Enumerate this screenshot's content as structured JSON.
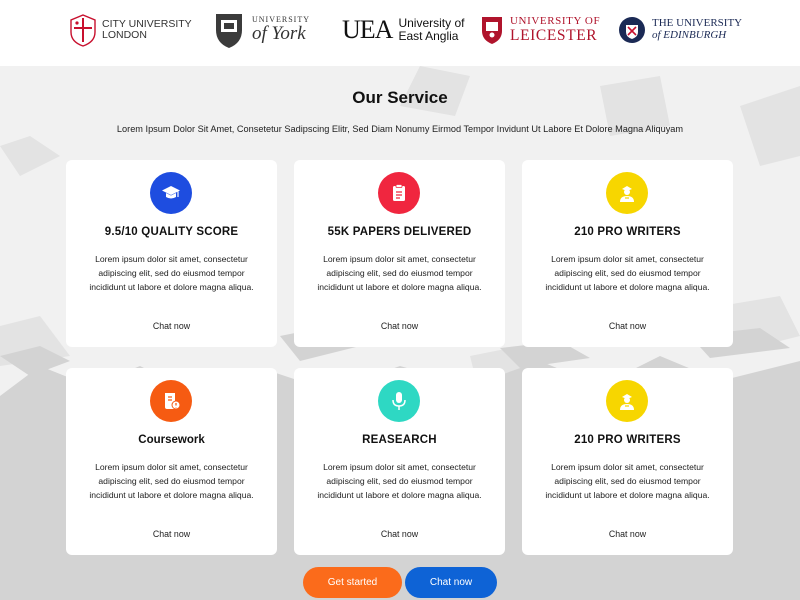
{
  "logos": {
    "city": {
      "line1": "CITY UNIVERSITY",
      "line2": "LONDON"
    },
    "york": {
      "line1": "UNIVERSITY",
      "line2": "of York"
    },
    "uea": {
      "mark": "UEA",
      "line1": "University of",
      "line2": "East Anglia"
    },
    "leicester": {
      "line1": "UNIVERSITY OF",
      "line2": "LEICESTER"
    },
    "edinburgh": {
      "line1": "THE UNIVERSITY",
      "line2": "of EDINBURGH"
    }
  },
  "service": {
    "title": "Our Service",
    "subtitle": "Lorem Ipsum Dolor Sit Amet, Consetetur Sadipscing Elitr, Sed Diam Nonumy Eirmod Tempor Invidunt Ut Labore Et Dolore Magna Aliquyam"
  },
  "cards": [
    {
      "title": "9.5/10 QUALITY SCORE",
      "text": "Lorem ipsum dolor sit amet, consectetur adipiscing elit, sed do eiusmod tempor incididunt ut labore et dolore magna aliqua.",
      "link": "Chat now",
      "icon": "graduation-cap-icon",
      "color": "#1e4de0"
    },
    {
      "title": "55K PAPERS DELIVERED",
      "text": "Lorem ipsum dolor sit amet, consectetur adipiscing elit, sed do eiusmod tempor incididunt ut labore et dolore magna aliqua.",
      "link": "Chat now",
      "icon": "clipboard-icon",
      "color": "#f0263f"
    },
    {
      "title": "210 PRO WRITERS",
      "text": "Lorem ipsum dolor sit amet, consectetur adipiscing elit, sed do eiusmod tempor incididunt ut labore et dolore magna aliqua.",
      "link": "Chat now",
      "icon": "writer-icon",
      "color": "#f7d600"
    },
    {
      "title": "Coursework",
      "text": "Lorem ipsum dolor sit amet, consectetur adipiscing elit, sed do eiusmod tempor incididunt ut labore et dolore magna aliqua.",
      "link": "Chat now",
      "icon": "book-icon",
      "color": "#f65b12"
    },
    {
      "title": "REASEARCH",
      "text": "Lorem ipsum dolor sit amet, consectetur adipiscing elit, sed do eiusmod tempor incididunt ut labore et dolore magna aliqua.",
      "link": "Chat now",
      "icon": "microphone-icon",
      "color": "#2ed8c3"
    },
    {
      "title": "210 PRO WRITERS",
      "text": "Lorem ipsum dolor sit amet, consectetur adipiscing elit, sed do eiusmod tempor incididunt ut labore et dolore magna aliqua.",
      "link": "Chat now",
      "icon": "writer-icon",
      "color": "#f7d600"
    }
  ],
  "buttons": {
    "get_started": "Get started",
    "chat_now": "Chat now",
    "get_started_color": "#fb6b1b",
    "chat_now_color": "#0e63d6"
  }
}
